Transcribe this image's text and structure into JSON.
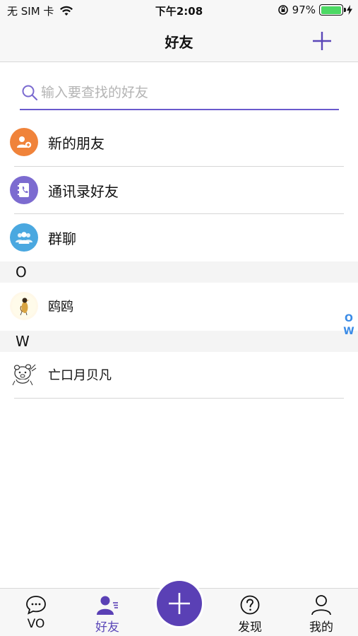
{
  "status_bar": {
    "carrier": "无 SIM 卡",
    "time": "下午2:08",
    "battery_percent": "97%",
    "battery_level": 0.97
  },
  "nav": {
    "title": "好友"
  },
  "search": {
    "placeholder": "输入要查找的好友",
    "value": ""
  },
  "shortcuts": [
    {
      "label": "新的朋友",
      "color": "#f0833a",
      "icon": "add-user-icon"
    },
    {
      "label": "通讯录好友",
      "color": "#7c6bd0",
      "icon": "contacts-book-icon"
    },
    {
      "label": "群聊",
      "color": "#4aa8e0",
      "icon": "group-icon"
    }
  ],
  "sections": [
    {
      "letter": "O",
      "contacts": [
        {
          "name": "鸥鸥",
          "avatar": "bird-avatar"
        }
      ]
    },
    {
      "letter": "W",
      "contacts": [
        {
          "name": "亡口月贝凡",
          "avatar": "sketch-avatar"
        }
      ]
    }
  ],
  "index_letters": [
    "O",
    "W"
  ],
  "tabbar": {
    "tabs": [
      {
        "label": "VO",
        "icon": "chat-bubble-icon"
      },
      {
        "label": "好友",
        "icon": "friends-icon"
      },
      {
        "label": "发现",
        "icon": "question-circle-icon"
      },
      {
        "label": "我的",
        "icon": "person-icon"
      }
    ],
    "active_tab": "好友",
    "accent": "#5a40b5"
  }
}
